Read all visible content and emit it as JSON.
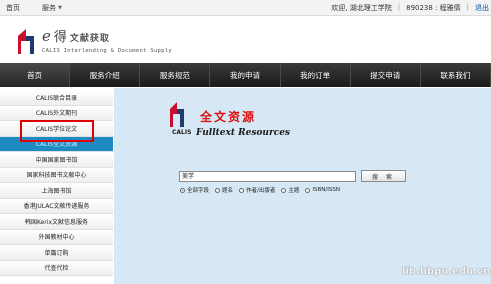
{
  "topbar": {
    "home_label": "首页",
    "service_label": "服务",
    "welcome": "欢迎, 湖北理工学院",
    "account": "890238 : 程雅倩",
    "logout": "退出"
  },
  "brand": {
    "e_letter": "e",
    "title_cn": "得",
    "subtitle_cn": "文献获取",
    "tagline": "CALIS Interlending & Document Supply"
  },
  "nav": {
    "items": [
      "首页",
      "服务介绍",
      "服务规范",
      "我的申请",
      "我的订单",
      "提交申请",
      "联系我们"
    ]
  },
  "sidebar": {
    "items": [
      "CALIS联合目录",
      "CALIS外文期刊",
      "CALIS学位论文",
      "CALIS全文资源",
      "中国国家图书馆",
      "国家科技图书文献中心",
      "上海图书馆",
      "香港JULAC文献传递服务",
      "韩国Kerix文献信息服务",
      "外国教材中心",
      "单篇订购",
      "代查代检"
    ],
    "current_index": 3
  },
  "fulltext": {
    "calis": "CALIS",
    "title_cn": "全文资源",
    "title_en": "Fulltext Resources"
  },
  "search": {
    "query": "美学",
    "button": "搜 索",
    "options": [
      "全部字段",
      "题名",
      "作者/出版者",
      "主题",
      "ISBN/ISSN"
    ],
    "selected": "全部字段"
  },
  "watermark": "lib.hbpu.edu.cn",
  "colors": {
    "nav_bg": "#222222",
    "highlight": "#e00000",
    "content_bg": "#d6e8f5",
    "sidebar_current": "#1f8bc3"
  }
}
